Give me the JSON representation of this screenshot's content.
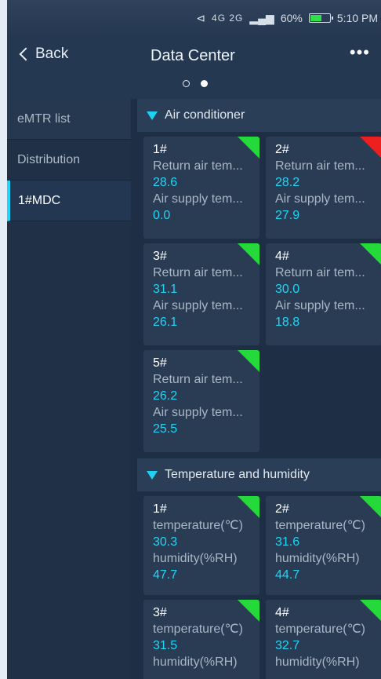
{
  "status": {
    "network": "4G 2G",
    "battery_pct": "60%",
    "battery_level": 0.6,
    "time": "5:10 PM"
  },
  "nav": {
    "back_label": "Back",
    "title": "Data Center",
    "more_label": "•••"
  },
  "sidebar": {
    "items": [
      {
        "label": "eMTR list"
      },
      {
        "label": "Distribution"
      },
      {
        "label": "1#MDC",
        "selected": true
      }
    ]
  },
  "sections": {
    "ac": {
      "title": "Air conditioner",
      "units": [
        {
          "id": "1#",
          "label1": "Return air tem...",
          "value1": "28.6",
          "label2": "Air supply tem...",
          "value2": "0.0",
          "status": "green"
        },
        {
          "id": "2#",
          "label1": "Return air tem...",
          "value1": "28.2",
          "label2": "Air supply tem...",
          "value2": "27.9",
          "status": "red"
        },
        {
          "id": "3#",
          "label1": "Return air tem...",
          "value1": "31.1",
          "label2": "Air supply tem...",
          "value2": "26.1",
          "status": "green"
        },
        {
          "id": "4#",
          "label1": "Return air tem...",
          "value1": "30.0",
          "label2": "Air supply tem...",
          "value2": "18.8",
          "status": "green"
        },
        {
          "id": "5#",
          "label1": "Return air tem...",
          "value1": "26.2",
          "label2": "Air supply tem...",
          "value2": "25.5",
          "status": "green"
        }
      ]
    },
    "th": {
      "title": "Temperature and humidity",
      "units": [
        {
          "id": "1#",
          "label1": "temperature(℃)",
          "value1": "30.3",
          "label2": "humidity(%RH)",
          "value2": "47.7",
          "status": "green"
        },
        {
          "id": "2#",
          "label1": "temperature(℃)",
          "value1": "31.6",
          "label2": "humidity(%RH)",
          "value2": "44.7",
          "status": "green"
        },
        {
          "id": "3#",
          "label1": "temperature(℃)",
          "value1": "31.5",
          "label2": "humidity(%RH)",
          "value2": "",
          "status": "green"
        },
        {
          "id": "4#",
          "label1": "temperature(℃)",
          "value1": "32.7",
          "label2": "humidity(%RH)",
          "value2": "",
          "status": "green"
        }
      ]
    }
  },
  "colors": {
    "accent": "#20d6f5",
    "ok": "#26d93a",
    "alarm": "#ee1f1f"
  }
}
